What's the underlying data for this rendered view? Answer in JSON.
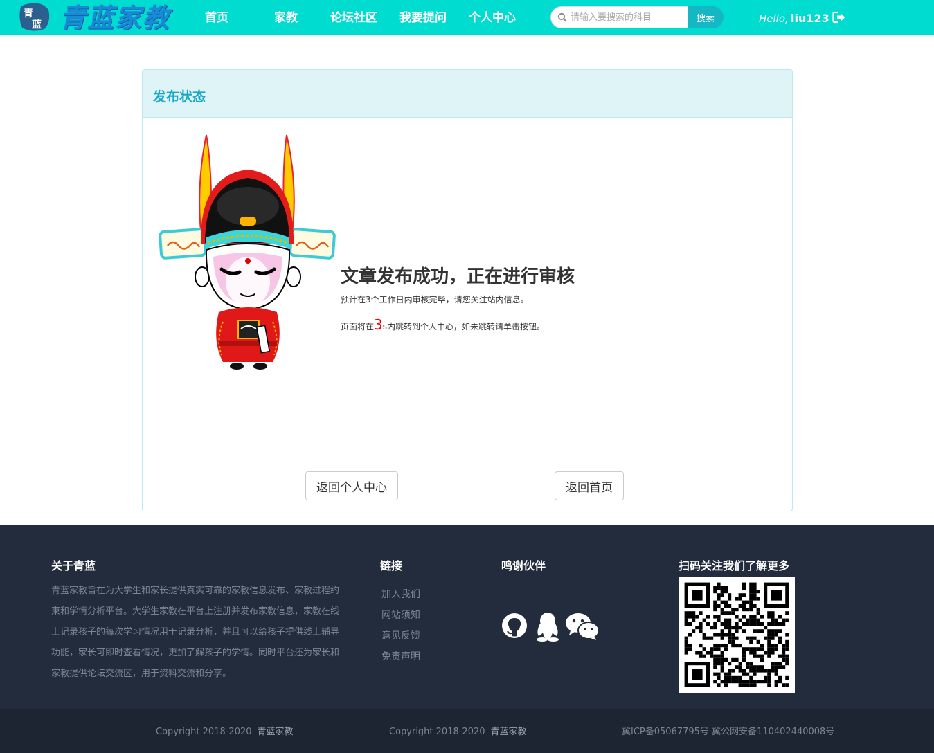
{
  "navbar": {
    "logo_seal_text": "青蓝",
    "logo_text": "青蓝家教",
    "items": [
      {
        "label": "首页"
      },
      {
        "label": "家教"
      },
      {
        "label": "论坛社区"
      },
      {
        "label": "我要提问"
      },
      {
        "label": "个人中心"
      }
    ],
    "search": {
      "placeholder": "请输入要搜索的科目",
      "button": "搜索"
    },
    "greeting": "Hello,",
    "username": "liu123",
    "bg_color": "#00dcd0"
  },
  "panel": {
    "title": "发布状态",
    "message_title": "文章发布成功，正在进行审核",
    "message_sub": "预计在3个工作日内审核完毕，请您关注站内信息。",
    "redirect_before": "页面将在",
    "countdown": "3",
    "redirect_after": "s内跳转到个人中心，如未跳转请单击按钮。",
    "btn_personal": "返回个人中心",
    "btn_home": "返回首页"
  },
  "footer": {
    "about_title": "关于青蓝",
    "about_text": "青蓝家教旨在为大学生和家长提供真实可靠的家教信息发布、家教过程约束和学情分析平台。大学生家教在平台上注册并发布家教信息，家教在线上记录孩子的每次学习情况用于记录分析，并且可以给孩子提供线上辅导功能，家长可即时查看情况，更加了解孩子的学情。同时平台还为家长和家教提供论坛交流区，用于资料交流和分享。",
    "links_title": "链接",
    "links": [
      "加入我们",
      "网站须知",
      "意见反馈",
      "免责声明"
    ],
    "partners_title": "鸣谢伙伴",
    "qr_title": "扫码关注我们了解更多",
    "copyright_1": "Copyright 2018-2020",
    "brand_1": "青蓝家教",
    "copyright_2": "Copyright 2018-2020",
    "brand_2": "青蓝家教",
    "icp": "冀ICP备05067795号 冀公网安备110402440008号"
  }
}
